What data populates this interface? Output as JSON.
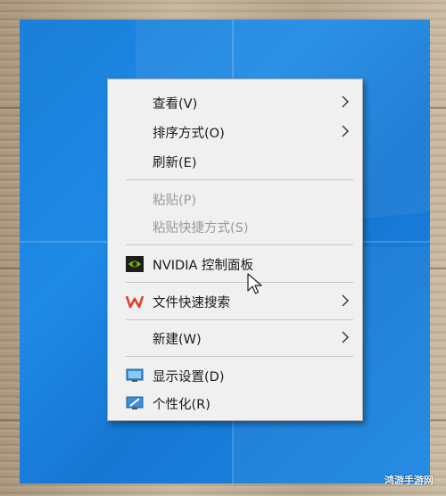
{
  "menu": {
    "items": [
      {
        "label": "查看(V)",
        "submenu": true,
        "disabled": false
      },
      {
        "label": "排序方式(O)",
        "submenu": true,
        "disabled": false
      },
      {
        "label": "刷新(E)",
        "submenu": false,
        "disabled": false
      },
      {
        "label": "粘贴(P)",
        "submenu": false,
        "disabled": true
      },
      {
        "label": "粘贴快捷方式(S)",
        "submenu": false,
        "disabled": true
      },
      {
        "label": "NVIDIA 控制面板",
        "submenu": false,
        "disabled": false,
        "icon": "nvidia-icon"
      },
      {
        "label": "文件快速搜索",
        "submenu": true,
        "disabled": false,
        "icon": "wps-icon"
      },
      {
        "label": "新建(W)",
        "submenu": true,
        "disabled": false
      },
      {
        "label": "显示设置(D)",
        "submenu": false,
        "disabled": false,
        "icon": "display-settings-icon"
      },
      {
        "label": "个性化(R)",
        "submenu": false,
        "disabled": false,
        "icon": "personalize-icon"
      }
    ]
  },
  "watermark": "鸿游手游网",
  "colors": {
    "desktop_blue": "#1a7fd8",
    "menu_bg": "#f0f0f0",
    "disabled_text": "#9a9a9a",
    "nvidia_green": "#76b900",
    "wps_red": "#e0402d"
  }
}
